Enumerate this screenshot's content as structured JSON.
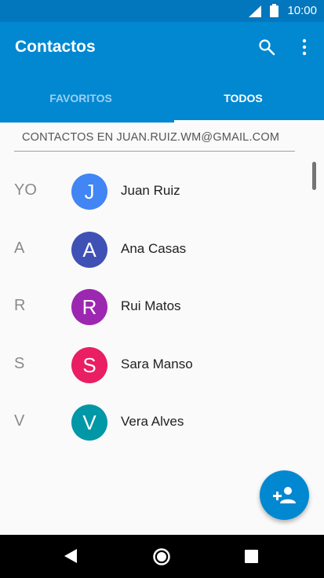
{
  "status_bar": {
    "time": "10:00"
  },
  "app_bar": {
    "title": "Contactos",
    "tabs": [
      {
        "label": "FAVORITOS",
        "selected": false
      },
      {
        "label": "TODOS",
        "selected": true
      }
    ]
  },
  "account_header": "CONTACTOS EN JUAN.RUIZ.WM@GMAIL.COM",
  "contacts": [
    {
      "section": "YO",
      "initial": "J",
      "name": "Juan Ruiz",
      "color": "#4285f4"
    },
    {
      "section": "A",
      "initial": "A",
      "name": "Ana Casas",
      "color": "#3f51b5"
    },
    {
      "section": "R",
      "initial": "R",
      "name": "Rui Matos",
      "color": "#9c27b0"
    },
    {
      "section": "S",
      "initial": "S",
      "name": "Sara Manso",
      "color": "#e91e63"
    },
    {
      "section": "V",
      "initial": "V",
      "name": "Vera Alves",
      "color": "#0097a7"
    }
  ],
  "icons": {
    "search": "search-icon",
    "more": "more-vert-icon",
    "fab": "add-person-icon",
    "nav": [
      "back-icon",
      "home-icon",
      "recents-icon"
    ]
  },
  "colors": {
    "primary": "#0288d1",
    "primary_dark": "#0277bd"
  }
}
